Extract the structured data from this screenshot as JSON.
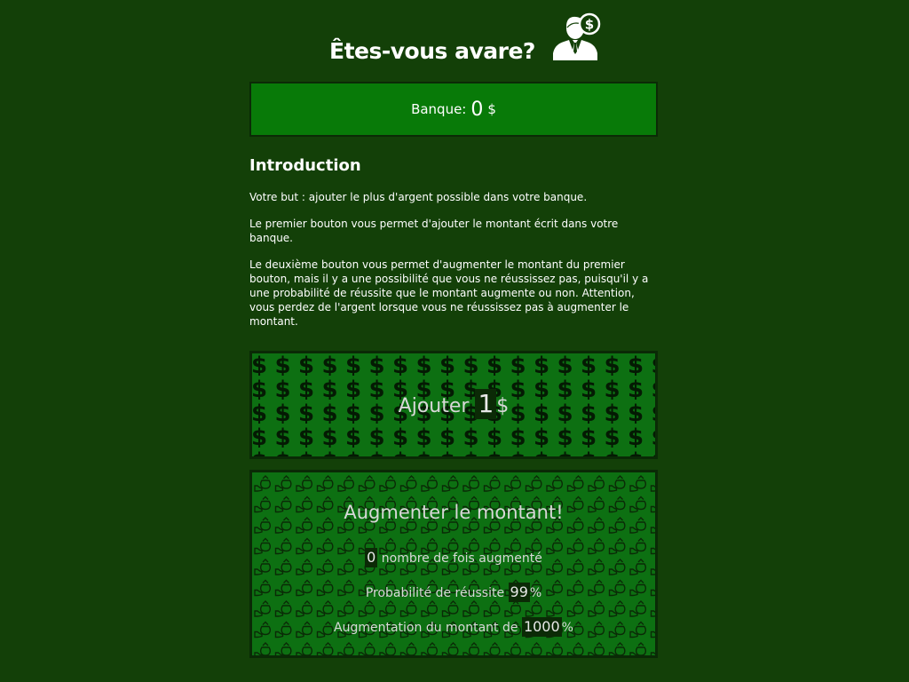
{
  "header": {
    "title": "Êtes-vous avare?",
    "icon": "businessman-dollar-icon"
  },
  "bank": {
    "label": "Banque:",
    "value": "0",
    "currency": "$"
  },
  "intro": {
    "heading": "Introduction",
    "p1": "Votre but : ajouter le plus d'argent possible dans votre banque.",
    "p2": "Le premier bouton vous permet d'ajouter le montant écrit dans votre banque.",
    "p3": "Le deuxième bouton vous permet d'augmenter le montant du premier bouton, mais il y a une possibilité que vous ne réussissez pas, puisqu'il y a une probabilité de réussite que le montant augmente ou non. Attention, vous perdez de l'argent lorsque vous ne réussissez pas à augmenter le montant."
  },
  "add_button": {
    "label": "Ajouter",
    "amount": "1",
    "currency": "$",
    "pattern_icon": "dollar-sign-icon"
  },
  "increase_button": {
    "title": "Augmenter le montant!",
    "times_value": "0",
    "times_label": "nombre de fois augmenté",
    "probability_label": "Probabilité de réussite",
    "probability_value": "99",
    "probability_unit": "%",
    "increase_label": "Augmentation du montant de",
    "increase_value": "1000",
    "increase_unit": "%",
    "pattern_icon": "money-bag-hand-icon"
  },
  "colors": {
    "background": "#134008",
    "bank_bg": "#087a08",
    "button_bg": "#0d7012",
    "dark": "#0a2a06"
  }
}
